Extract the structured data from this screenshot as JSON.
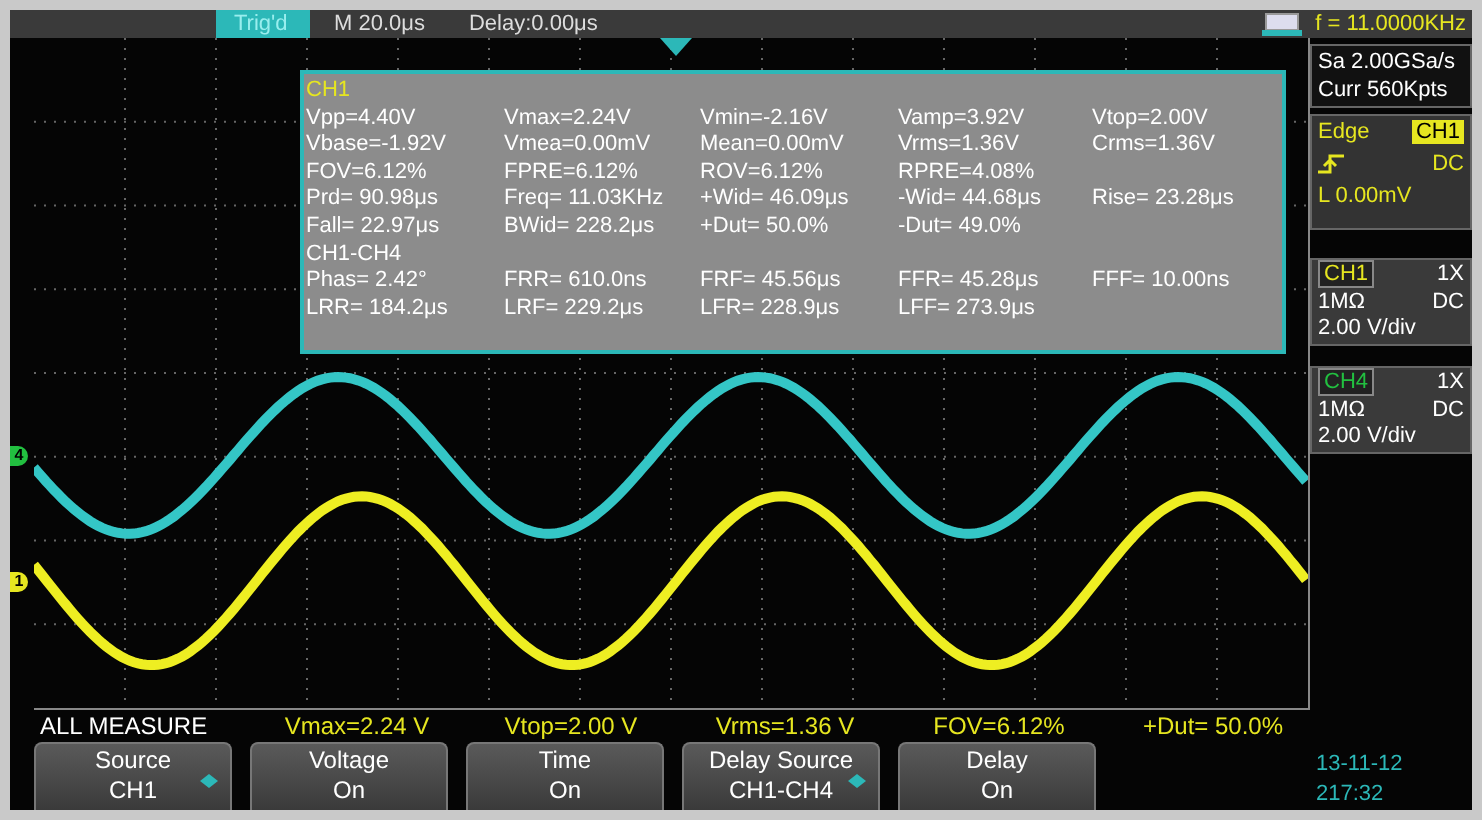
{
  "top_bar": {
    "trigger_status": "Trig'd",
    "timebase": "M 20.0μs",
    "delay": "Delay:0.00μs",
    "frequency": "f = 11.0000KHz"
  },
  "traces": [
    {
      "marker": {
        "label": "4",
        "color": "#22c040"
      },
      "color": "#34c6c6"
    },
    {
      "marker": {
        "label": "1",
        "color": "#e6e620"
      },
      "color": "#eeee22"
    }
  ],
  "measure_panel": {
    "sections": [
      {
        "title": "CH1",
        "color": "#e6e620",
        "rows": [
          [
            "Vpp=4.40V",
            "Vmax=2.24V",
            "Vmin=-2.16V",
            "Vamp=3.92V",
            "Vtop=2.00V"
          ],
          [
            "Vbase=-1.92V",
            "Vmea=0.00mV",
            "Mean=0.00mV",
            "Vrms=1.36V",
            "Crms=1.36V"
          ],
          [
            "FOV=6.12%",
            "FPRE=6.12%",
            "ROV=6.12%",
            "RPRE=4.08%"
          ],
          [
            "Prd= 90.98μs",
            "Freq= 11.03KHz",
            "+Wid= 46.09μs",
            "-Wid= 44.68μs",
            "Rise= 23.28μs"
          ],
          [
            "Fall= 22.97μs",
            "BWid= 228.2μs",
            "+Dut= 50.0%",
            "-Dut= 49.0%"
          ]
        ]
      },
      {
        "title": "CH1-CH4",
        "color": "#ffffff",
        "rows": [
          [
            "Phas= 2.42°",
            "FRR= 610.0ns",
            "FRF= 45.56μs",
            "FFR= 45.28μs",
            "FFF= 10.00ns"
          ],
          [
            "LRR= 184.2μs",
            "LRF= 229.2μs",
            "LFR= 228.9μs",
            "LFF= 273.9μs"
          ]
        ]
      }
    ]
  },
  "side_panel": {
    "sample_rate": "Sa 2.00GSa/s",
    "memory": "Curr 560Kpts",
    "trigger": {
      "type": "Edge",
      "source": "CH1",
      "coupling": "DC",
      "level": "L 0.00mV"
    },
    "channels": [
      {
        "name": "CH1",
        "color": "#e6e620",
        "probe": "1X",
        "impedance": "1MΩ",
        "coupling": "DC",
        "scale": "2.00 V/div"
      },
      {
        "name": "CH4",
        "color": "#22c040",
        "probe": "1X",
        "impedance": "1MΩ",
        "coupling": "DC",
        "scale": "2.00 V/div"
      }
    ]
  },
  "measure_bar": {
    "label": "ALL MEASURE",
    "values": [
      "Vmax=2.24 V",
      "Vtop=2.00 V",
      "Vrms=1.36 V",
      "FOV=6.12%",
      "+Dut= 50.0%"
    ]
  },
  "softkeys": [
    {
      "line1": "Source",
      "line2": "CH1",
      "selector": true
    },
    {
      "line1": "Voltage",
      "line2": "On",
      "selector": false
    },
    {
      "line1": "Time",
      "line2": "On",
      "selector": false
    },
    {
      "line1": "Delay Source",
      "line2": "CH1-CH4",
      "selector": true
    },
    {
      "line1": "Delay",
      "line2": "On",
      "selector": false
    }
  ],
  "clock": {
    "date": "13-11-12",
    "time": "217:32"
  }
}
